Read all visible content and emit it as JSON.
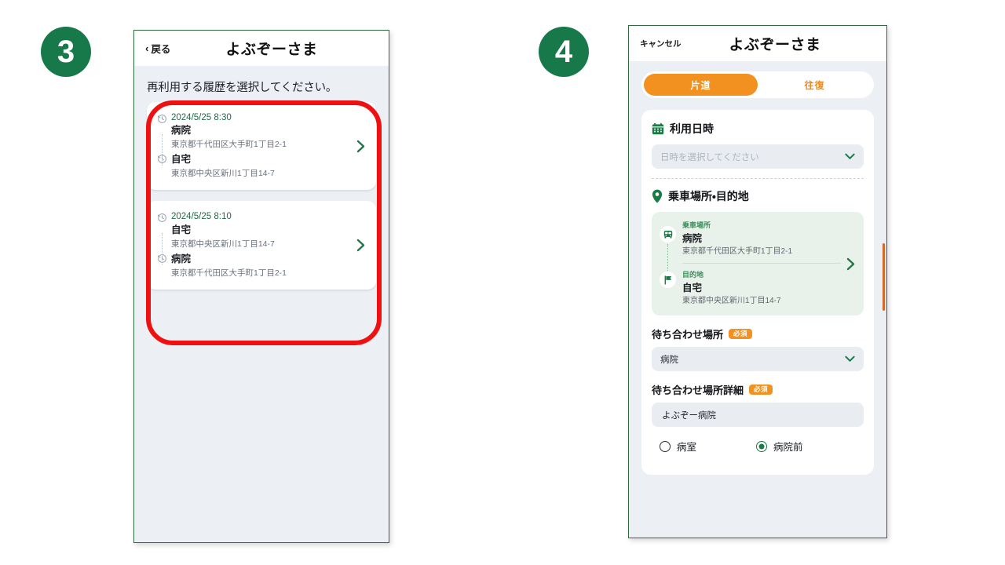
{
  "theme": {
    "brand_green": "#17794a",
    "accent_orange": "#f2911f",
    "highlight_red": "#ee1111",
    "screen_bg": "#eceff4",
    "card_white": "#ffffff",
    "route_card_green": "#e9f2ea"
  },
  "steps": [
    {
      "number": "3"
    },
    {
      "number": "4"
    }
  ],
  "screen3": {
    "header": {
      "back_label": "戻る",
      "back_icon": "chevron-left-icon",
      "title": "よぶぞーさま"
    },
    "prompt": "再利用する履歴を選択してください。",
    "history": [
      {
        "time": "2024/5/25 8:30",
        "origin": {
          "name": "病院",
          "address": "東京都千代田区大手町1丁目2-1"
        },
        "destination": {
          "name": "自宅",
          "address": "東京都中央区新川1丁目14-7"
        }
      },
      {
        "time": "2024/5/25 8:10",
        "origin": {
          "name": "自宅",
          "address": "東京都中央区新川1丁目14-7"
        },
        "destination": {
          "name": "病院",
          "address": "東京都千代田区大手町1丁目2-1"
        }
      }
    ]
  },
  "screen4": {
    "header": {
      "cancel_label": "キャンセル",
      "title": "よぶぞーさま"
    },
    "trip_type_tabs": [
      {
        "label": "片道",
        "active": true
      },
      {
        "label": "往復",
        "active": false
      }
    ],
    "datetime_section": {
      "icon": "calendar-icon",
      "title": "利用日時",
      "select_placeholder": "日時を選択してください",
      "select_value": ""
    },
    "route_section": {
      "icon": "location-pin-icon",
      "title": "乗車場所・目的地",
      "pickup": {
        "label": "乗車場所",
        "icon": "bus-icon",
        "name": "病院",
        "address": "東京都千代田区大手町1丁目2-1"
      },
      "dropoff": {
        "label": "目的地",
        "icon": "flag-icon",
        "name": "自宅",
        "address": "東京都中央区新川1丁目14-7"
      }
    },
    "meeting_place": {
      "label": "待ち合わせ場所",
      "required_badge": "必須",
      "value": "病院"
    },
    "meeting_detail": {
      "label": "待ち合わせ場所詳細",
      "required_badge": "必須",
      "value": "よぶぞー病院"
    },
    "meeting_options": [
      {
        "label": "病室",
        "selected": false
      },
      {
        "label": "病院前",
        "selected": true
      }
    ]
  }
}
